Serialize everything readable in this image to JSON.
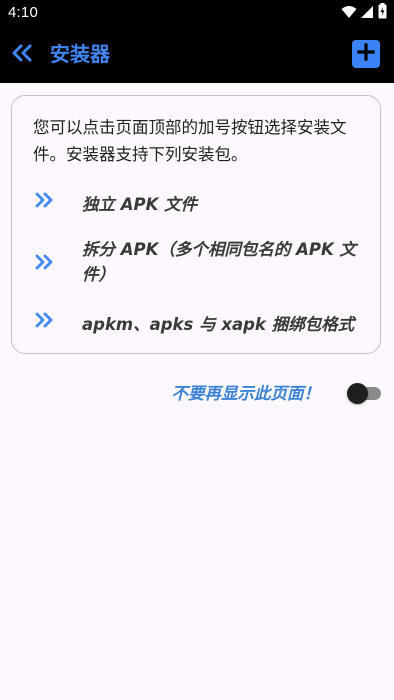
{
  "status_bar": {
    "time": "4:10",
    "icons": [
      "wifi-icon",
      "signal-icon",
      "battery-icon"
    ]
  },
  "app_bar": {
    "title": "安装器",
    "back_icon": "double-chevron-left-icon",
    "add_icon": "add-box-icon"
  },
  "info_card": {
    "intro": "您可以点击页面顶部的加号按钮选择安装文件。安装器支持下列安装包。",
    "items": [
      {
        "icon": "double-chevron-right-icon",
        "label": "独立 APK 文件"
      },
      {
        "icon": "double-chevron-right-icon",
        "label": "拆分 APK（多个相同包名的 APK 文件）"
      },
      {
        "icon": "double-chevron-right-icon",
        "label": "apkm、apks 与 xapk 捆绑包格式"
      }
    ]
  },
  "dont_show": {
    "label": "不要再显示此页面！",
    "toggle_on": false
  },
  "colors": {
    "accent": "#4285f4",
    "bar_background": "#000000",
    "page_background": "#fdf8fd",
    "add_button": "#3b82f6"
  }
}
